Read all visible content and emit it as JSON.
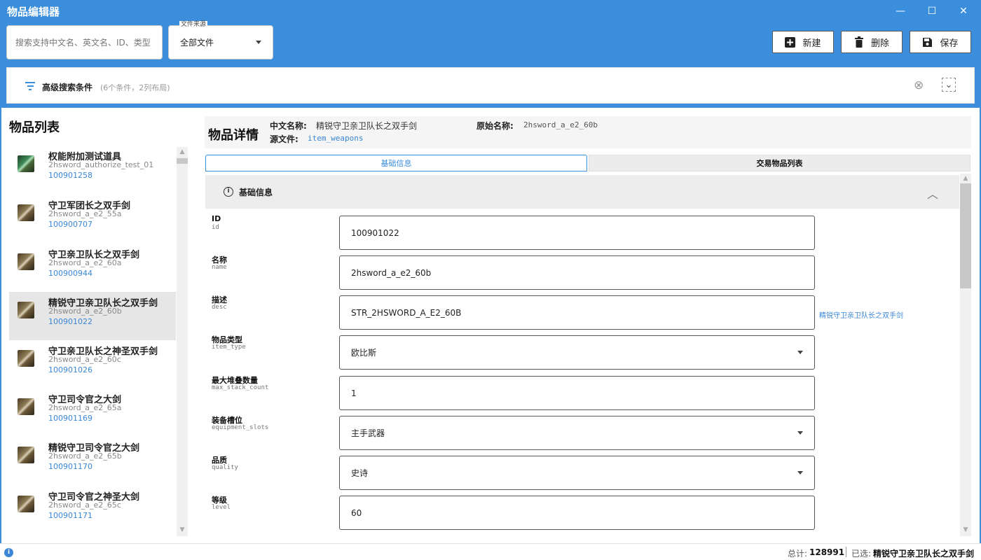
{
  "window": {
    "title": "物品编辑器",
    "minimize_icon": "—",
    "maximize_icon": "☐",
    "close_icon": "✕"
  },
  "toolbar": {
    "search_placeholder": "搜索支持中文名、英文名、ID、类型",
    "source_legend": "文件来源",
    "source_selected": "全部文件",
    "new_label": "新建",
    "delete_label": "删除",
    "save_label": "保存"
  },
  "advanced_search": {
    "label": "高级搜索条件",
    "hint": "(6个条件，2列布局)",
    "clear_icon": "⊗",
    "expand_icon": "⌄"
  },
  "item_list": {
    "title": "物品列表",
    "items": [
      {
        "name": "权能附加测试道具",
        "code": "2hsword_authorize_test_01",
        "id": "100901258",
        "icon": "sword-icon-green",
        "selected": false
      },
      {
        "name": "守卫军团长之双手剑",
        "code": "2hsword_a_e2_55a",
        "id": "100900707",
        "icon": "sword-icon",
        "selected": false
      },
      {
        "name": "守卫亲卫队长之双手剑",
        "code": "2hsword_a_e2_60a",
        "id": "100900944",
        "icon": "sword-icon",
        "selected": false
      },
      {
        "name": "精锐守卫亲卫队长之双手剑",
        "code": "2hsword_a_e2_60b",
        "id": "100901022",
        "icon": "sword-icon",
        "selected": true
      },
      {
        "name": "守卫亲卫队长之神圣双手剑",
        "code": "2hsword_a_e2_60c",
        "id": "100901026",
        "icon": "sword-icon",
        "selected": false
      },
      {
        "name": "守卫司令官之大剑",
        "code": "2hsword_a_e2_65a",
        "id": "100901169",
        "icon": "sword-icon",
        "selected": false
      },
      {
        "name": "精锐守卫司令官之大剑",
        "code": "2hsword_a_e2_65b",
        "id": "100901170",
        "icon": "sword-icon",
        "selected": false
      },
      {
        "name": "守卫司令官之神圣大剑",
        "code": "2hsword_a_e2_65c",
        "id": "100901171",
        "icon": "sword-icon",
        "selected": false
      }
    ]
  },
  "detail": {
    "title": "物品详情",
    "cn_name_label": "中文名称:",
    "cn_name": "精锐守卫亲卫队长之双手剑",
    "orig_name_label": "原始名称:",
    "orig_name": "2hsword_a_e2_60b",
    "source_label": "源文件:",
    "source": "item_weapons",
    "tabs": [
      {
        "label": "基础信息",
        "active": true
      },
      {
        "label": "交易物品列表",
        "active": false
      }
    ],
    "section_title": "基础信息",
    "fields": [
      {
        "label": "ID",
        "key": "id",
        "value": "100901022",
        "dropdown": false,
        "note": ""
      },
      {
        "label": "名称",
        "key": "name",
        "value": "2hsword_a_e2_60b",
        "dropdown": false,
        "note": ""
      },
      {
        "label": "描述",
        "key": "desc",
        "value": "STR_2HSWORD_A_E2_60B",
        "dropdown": false,
        "note": "精锐守卫亲卫队长之双手剑"
      },
      {
        "label": "物品类型",
        "key": "item_type",
        "value": "欧比斯",
        "dropdown": true,
        "note": ""
      },
      {
        "label": "最大堆叠数量",
        "key": "max_stack_count",
        "value": "1",
        "dropdown": false,
        "note": ""
      },
      {
        "label": "装备槽位",
        "key": "equipment_slots",
        "value": "主手武器",
        "dropdown": true,
        "note": ""
      },
      {
        "label": "品质",
        "key": "quality",
        "value": "史诗",
        "dropdown": true,
        "note": ""
      },
      {
        "label": "等级",
        "key": "level",
        "value": "60",
        "dropdown": false,
        "note": ""
      }
    ]
  },
  "status": {
    "total_label": "总计:",
    "total": "128991",
    "selected_label": "已选:",
    "selected": "精锐守卫亲卫队长之双手剑"
  },
  "colors": {
    "accent": "#3a8edc",
    "link": "#3a86d6",
    "selected_row": "#e6e6e6"
  }
}
